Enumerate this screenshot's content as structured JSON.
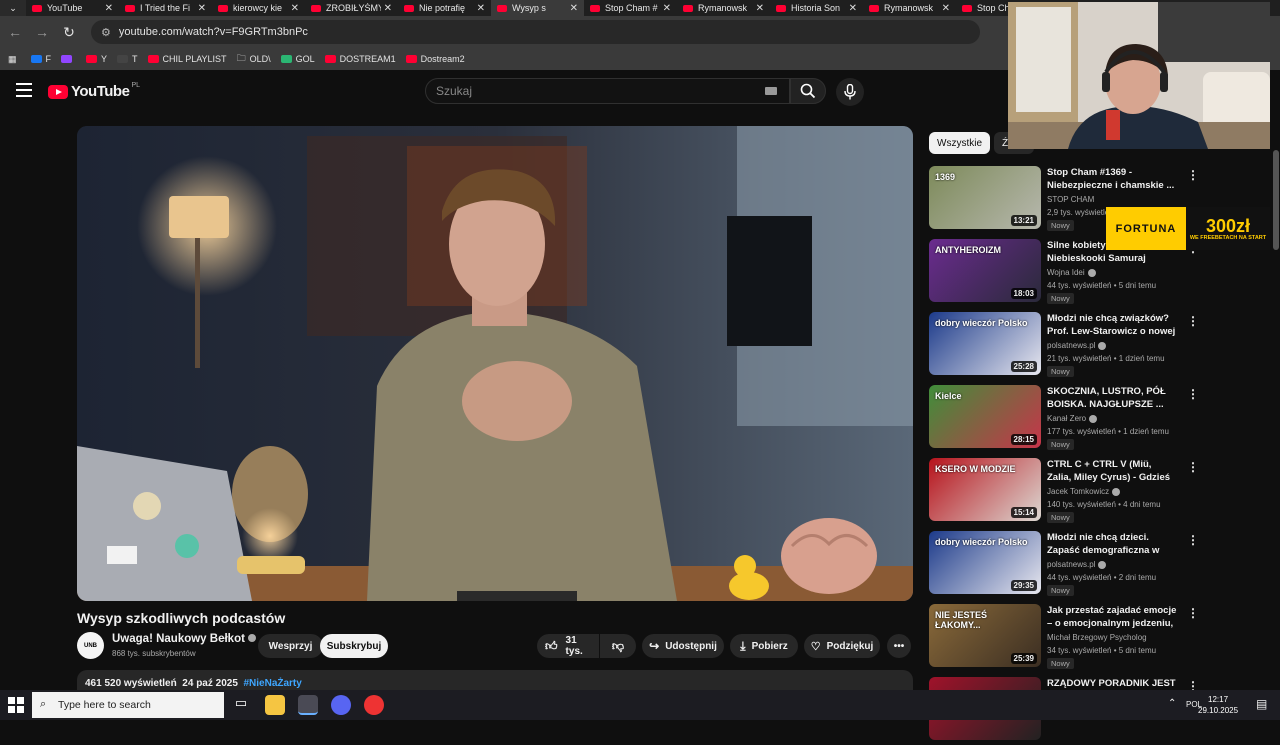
{
  "browser": {
    "tabs": [
      {
        "label": "YouTube",
        "active": false
      },
      {
        "label": "I Tried the Fi",
        "active": false
      },
      {
        "label": "kierowcy kie",
        "active": false
      },
      {
        "label": "ZROBIŁYŚMY",
        "active": false
      },
      {
        "label": "Nie potrafię",
        "active": false
      },
      {
        "label": "Wysyp s",
        "active": true
      },
      {
        "label": "Stop Cham #",
        "active": false
      },
      {
        "label": "Rymanowsk",
        "active": false
      },
      {
        "label": "Historia Son",
        "active": false
      },
      {
        "label": "Rymanowsk",
        "active": false
      },
      {
        "label": "Stop Cha",
        "active": false
      }
    ],
    "url": "youtube.com/watch?v=F9GRTm3bnPc",
    "bookmarks": [
      "F",
      "",
      "Y",
      "T",
      "CHIL PLAYLIST",
      "OLD\\",
      "GOL",
      "DOSTREAM1",
      "Dostream2"
    ]
  },
  "youtube": {
    "logo": "YouTube",
    "country": "PL",
    "search_placeholder": "Szukaj"
  },
  "video": {
    "title": "Wysyp szkodliwych podcastów",
    "channel": "Uwaga! Naukowy Bełkot",
    "channel_avatar_text": "UNB",
    "subscribers": "868 tys. subskrybentów",
    "join_label": "Wesprzyj",
    "subscribe_label": "Subskrybuj",
    "likes": "31 tys.",
    "share_label": "Udostępnij",
    "download_label": "Pobierz",
    "thanks_label": "Podziękuj",
    "views": "461 520 wyświetleń",
    "date": "24 paź 2025",
    "hashtag": "#NieNaŻarty"
  },
  "sidebar": {
    "chips": [
      "Wszystkie",
      "Ź"
    ],
    "recommendations": [
      {
        "title": "Stop Cham #1369 - Niebezpieczne i chamskie ...",
        "channel": "STOP CHAM",
        "verified": false,
        "views": "2,9 tys. wyświetleń",
        "age": "",
        "badge": "Nowy",
        "duration": "13:21",
        "colors": [
          "#7d8a5a",
          "#b7b8ae"
        ],
        "thumb_text": "1369"
      },
      {
        "title": "Silne kobiety w kinie - Niebieskooki Samuraj",
        "channel": "Wojna Idei",
        "verified": true,
        "views": "44 tys. wyświetleń",
        "age": "5 dni temu",
        "badge": "Nowy",
        "duration": "18:03",
        "colors": [
          "#6b2b8f",
          "#2a2a3a"
        ],
        "thumb_text": "ANTYHEROIZM"
      },
      {
        "title": "Młodzi nie chcą związków? Prof. Lew-Starowicz o nowej ...",
        "channel": "polsatnews.pl",
        "verified": true,
        "views": "21 tys. wyświetleń",
        "age": "1 dzień temu",
        "badge": "Nowy",
        "duration": "25:28",
        "colors": [
          "#1c3a8a",
          "#e8e8ef"
        ],
        "thumb_text": "dobry wieczór Polsko"
      },
      {
        "title": "SKOCZNIA, LUSTRO, PÓŁ BOISKA. NAJGŁUPSZE ...",
        "channel": "Kanał Zero",
        "verified": true,
        "views": "177 tys. wyświetleń",
        "age": "1 dzień temu",
        "badge": "Nowy",
        "duration": "28:15",
        "colors": [
          "#3f8e3a",
          "#c8344a"
        ],
        "thumb_text": "Kielce"
      },
      {
        "title": "CTRL C + CTRL V (Miü, Zalia, Miley Cyrus) - Gdzieś to już ...",
        "channel": "Jacek Tomkowicz",
        "verified": true,
        "views": "140 tys. wyświetleń",
        "age": "4 dni temu",
        "badge": "Nowy",
        "duration": "15:14",
        "colors": [
          "#b7121b",
          "#dcd8d2"
        ],
        "thumb_text": "KSERO W MODZIE"
      },
      {
        "title": "Młodzi nie chcą dzieci. Zapaść demograficzna w Polsce",
        "channel": "polsatnews.pl",
        "verified": true,
        "views": "44 tys. wyświetleń",
        "age": "2 dni temu",
        "badge": "Nowy",
        "duration": "29:35",
        "colors": [
          "#1c3a8a",
          "#e8e8ef"
        ],
        "thumb_text": "dobry wieczór Polsko"
      },
      {
        "title": "Jak przestać zajadać emocje – o emocjonalnym jedzeniu, ...",
        "channel": "Michał Brzegowy Psycholog",
        "verified": false,
        "views": "34 tys. wyświetleń",
        "age": "5 dni temu",
        "badge": "Nowy",
        "duration": "25:39",
        "colors": [
          "#8a6a3a",
          "#3b2e22"
        ],
        "thumb_text": "NIE JESTEŚ ŁAKOMY..."
      },
      {
        "title": "RZĄDOWY PORADNIK JEST",
        "channel": "",
        "verified": false,
        "views": "",
        "age": "",
        "badge": "",
        "duration": "",
        "colors": [
          "#a0122a",
          "#222"
        ],
        "thumb_text": ""
      }
    ]
  },
  "overlay": {
    "fortuna_brand": "FORTUNA",
    "fortuna_amount": "300zł",
    "fortuna_tagline": "WE FREEBETACH NA START"
  },
  "taskbar": {
    "search_placeholder": "Type here to search",
    "language": "POL",
    "time": "12:17",
    "date": "29.10.2025"
  }
}
